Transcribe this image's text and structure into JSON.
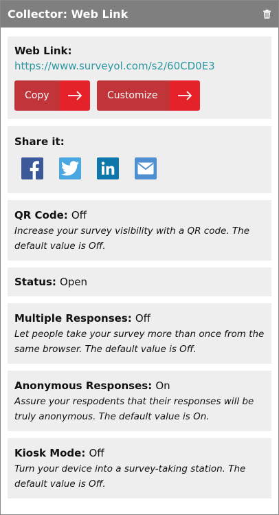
{
  "header": {
    "title": "Collector: Web Link",
    "trash_icon": "trash-icon"
  },
  "web_link": {
    "label": "Web Link:",
    "url": "https://www.surveyol.com/s2/60CD0E3",
    "copy_label": "Copy",
    "customize_label": "Customize"
  },
  "share": {
    "label": "Share it:",
    "icons": [
      "facebook-icon",
      "twitter-icon",
      "linkedin-icon",
      "email-icon"
    ]
  },
  "qr": {
    "label": "QR Code:",
    "value": "Off",
    "desc": "Increase your survey visibility with a QR code. The default value is Off."
  },
  "status": {
    "label": "Status:",
    "value": "Open"
  },
  "multiple": {
    "label": "Multiple Responses:",
    "value": "Off",
    "desc": "Let people take your survey more than once from the same browser. The default value is Off."
  },
  "anonymous": {
    "label": "Anonymous Responses:",
    "value": "On",
    "desc": "Assure your respodents that their responses will be truly anonymous. The default value is On."
  },
  "kiosk": {
    "label": "Kiosk Mode:",
    "value": "Off",
    "desc": "Turn your device into a survey-taking station. The default value is Off."
  },
  "colors": {
    "header": "#7f7f7f",
    "card": "#eeeeee",
    "button": "#c0343a",
    "button_accent": "#e52229",
    "link": "#2a97a2"
  }
}
